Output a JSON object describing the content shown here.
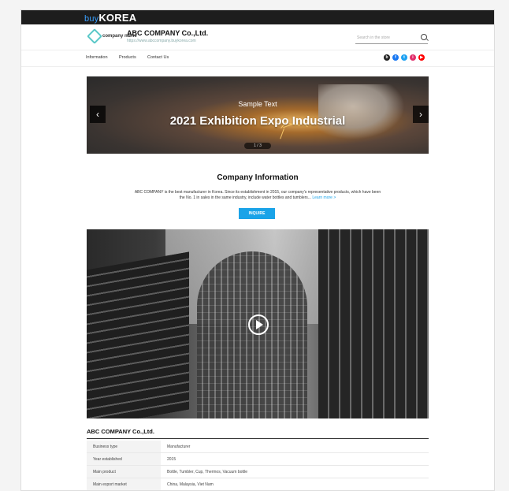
{
  "brand": {
    "prefix": "buy",
    "name": "KOREA"
  },
  "header": {
    "logo_text": "company name",
    "company_name": "ABC COMPANY Co.,Ltd.",
    "company_url": "https://www.abccompany.buykorea.com",
    "search_placeholder": "Search in the store"
  },
  "nav": {
    "items": [
      "Information",
      "Products",
      "Contact Us"
    ]
  },
  "socials": [
    {
      "icon": "blog-icon",
      "label": "b",
      "color": "#222222"
    },
    {
      "icon": "facebook-icon",
      "label": "f",
      "color": "#1877f2"
    },
    {
      "icon": "twitter-icon",
      "label": "t",
      "color": "#1da1f2"
    },
    {
      "icon": "instagram-icon",
      "label": "i",
      "color": "#e1306c"
    },
    {
      "icon": "youtube-icon",
      "label": "▶",
      "color": "#ff0000"
    }
  ],
  "hero": {
    "subtitle": "Sample Text",
    "title": "2021 Exhibition Expo Industrial",
    "prev": "‹",
    "next": "›",
    "pager": "1 / 3"
  },
  "info": {
    "title": "Company Information",
    "description": "ABC COMPANY is the best manufacturer in Korea. Since its establishment in 2015, our company's representative products, which have been the No. 1 in sales in the same industry, include water bottles and tumblers...",
    "more": "Learn more >",
    "inquire": "INQUIRE"
  },
  "details": {
    "title": "ABC COMPANY Co.,Ltd.",
    "rows": [
      {
        "key": "Business type",
        "value": "Manufacturer"
      },
      {
        "key": "Year established",
        "value": "2015"
      },
      {
        "key": "Main product",
        "value": "Bottle, Tumbler, Cup, Thermos, Vacuum bottle"
      },
      {
        "key": "Main export market",
        "value": "China, Malaysia, Viet Nam"
      }
    ]
  },
  "colors": {
    "accent": "#1aa3e8",
    "topbar": "#1d1d1d"
  }
}
